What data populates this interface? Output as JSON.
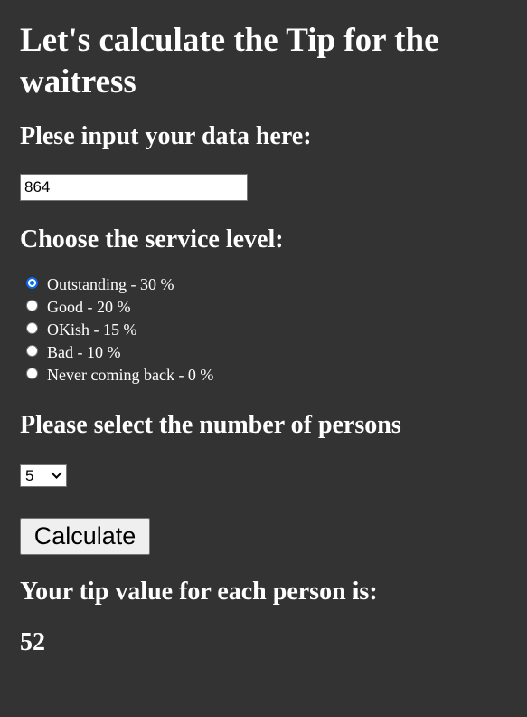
{
  "page": {
    "title": "Let's calculate the Tip for the waitress"
  },
  "bill": {
    "heading": "Plese input your data here:",
    "value": "864"
  },
  "service": {
    "heading": "Choose the service level:",
    "options": [
      {
        "label": "Outstanding - 30 %",
        "checked": true
      },
      {
        "label": "Good - 20 %",
        "checked": false
      },
      {
        "label": "OKish - 15 %",
        "checked": false
      },
      {
        "label": "Bad - 10 %",
        "checked": false
      },
      {
        "label": "Never coming back - 0 %",
        "checked": false
      }
    ]
  },
  "persons": {
    "heading": "Please select the number of persons",
    "selected": "5"
  },
  "actions": {
    "calculate_label": "Calculate"
  },
  "result": {
    "heading": "Your tip value for each person is:",
    "value": "52"
  }
}
